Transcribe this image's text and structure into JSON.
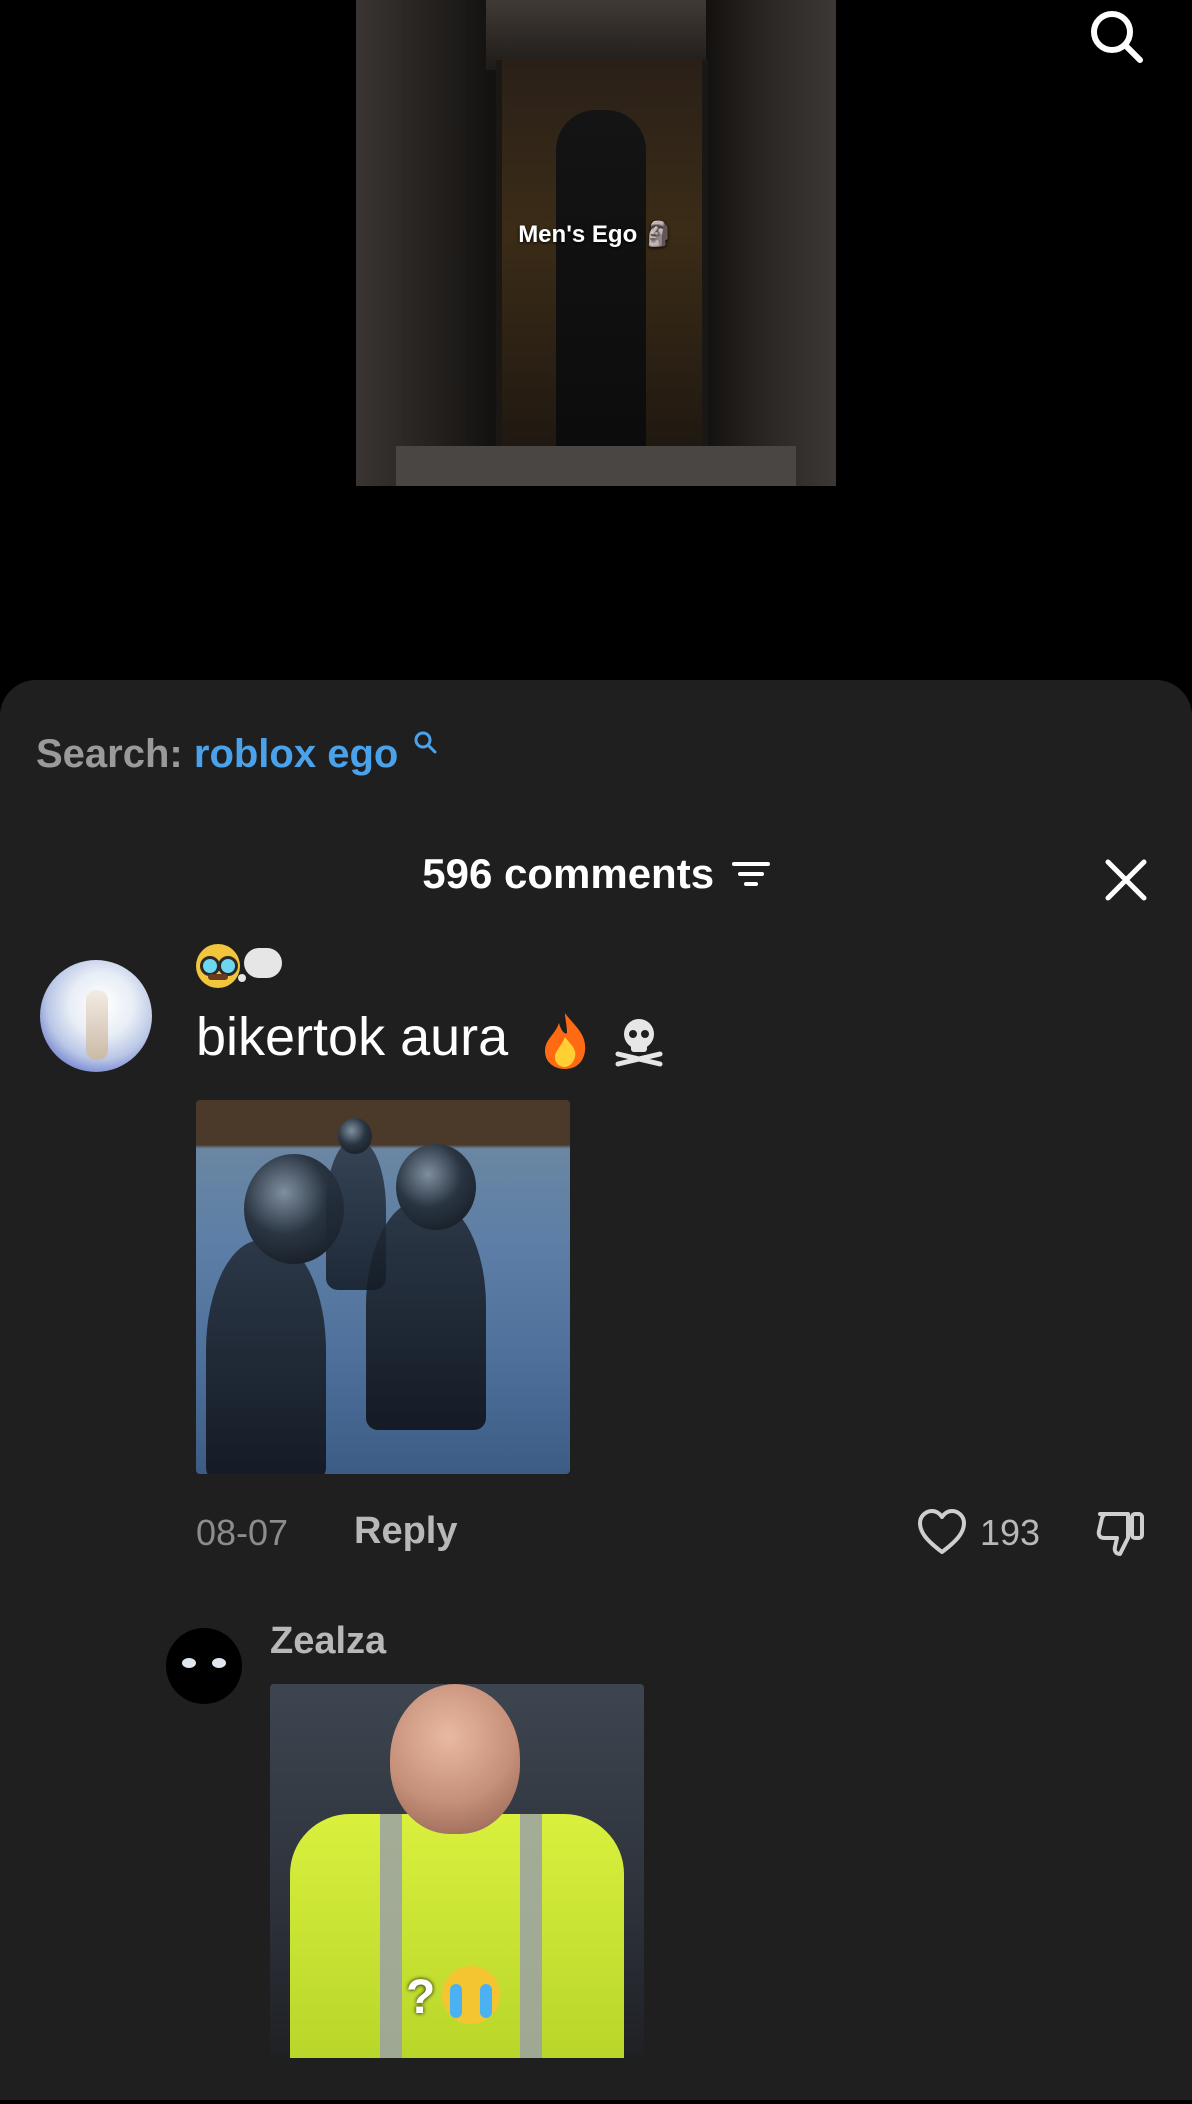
{
  "video": {
    "caption": "Men's Ego 🗿"
  },
  "sheet": {
    "search_label": "Search:",
    "search_term": "roblox ego",
    "comment_count": "596 comments"
  },
  "comments": [
    {
      "text": "bikertok aura",
      "date": "08-07",
      "reply_label": "Reply",
      "likes": "193"
    }
  ],
  "reply": {
    "author": "Zealza",
    "image_overlay": "?"
  },
  "colors": {
    "sheet_bg": "#1f1f1f",
    "search_term": "#4aa3ea",
    "muted_text": "#8c8c8c"
  }
}
